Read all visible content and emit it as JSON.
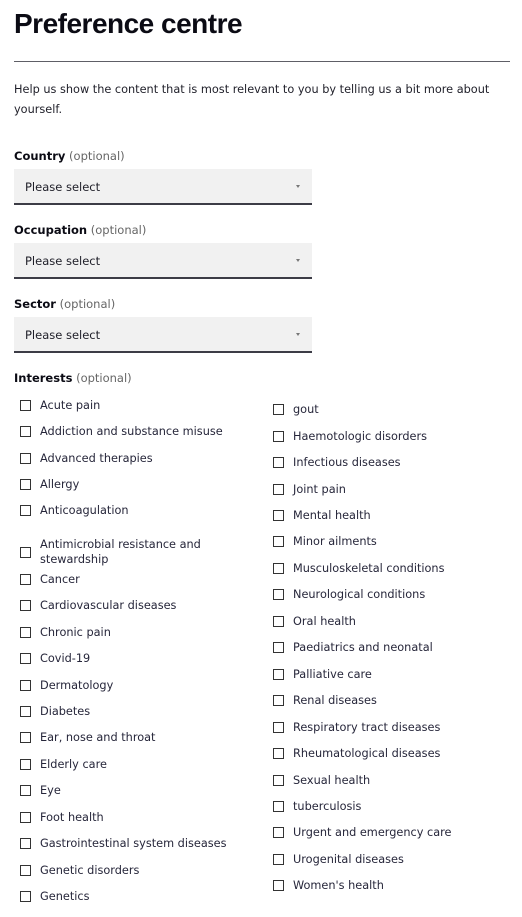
{
  "page": {
    "title": "Preference centre",
    "intro": "Help us show the content that is most relevant to you by telling us a bit more about yourself."
  },
  "fields": {
    "country": {
      "label": "Country",
      "optional": "(optional)",
      "value": "Please select"
    },
    "occupation": {
      "label": "Occupation",
      "optional": "(optional)",
      "value": "Please select"
    },
    "sector": {
      "label": "Sector",
      "optional": "(optional)",
      "value": "Please select"
    }
  },
  "interests": {
    "label": "Interests",
    "optional": "(optional)",
    "left_column": [
      {
        "label": "Acute pain",
        "checked": false
      },
      {
        "label": "Addiction and substance misuse",
        "checked": false
      },
      {
        "label": "Advanced therapies",
        "checked": false
      },
      {
        "label": "Allergy",
        "checked": false
      },
      {
        "label": "Anticoagulation",
        "checked": false
      },
      {
        "label": "Antimicrobial resistance and stewardship",
        "checked": false
      },
      {
        "label": "Cancer",
        "checked": false
      },
      {
        "label": "Cardiovascular diseases",
        "checked": false
      },
      {
        "label": "Chronic pain",
        "checked": false
      },
      {
        "label": "Covid-19",
        "checked": false
      },
      {
        "label": "Dermatology",
        "checked": false
      },
      {
        "label": "Diabetes",
        "checked": false
      },
      {
        "label": "Ear, nose and throat",
        "checked": false
      },
      {
        "label": "Elderly care",
        "checked": false
      },
      {
        "label": "Eye",
        "checked": false
      },
      {
        "label": "Foot health",
        "checked": false
      },
      {
        "label": "Gastrointestinal system diseases",
        "checked": false
      },
      {
        "label": "Genetic disorders",
        "checked": false
      },
      {
        "label": "Genetics",
        "checked": false
      }
    ],
    "right_column": [
      {
        "label": "gout",
        "checked": false
      },
      {
        "label": "Haemotologic disorders",
        "checked": false
      },
      {
        "label": "Infectious diseases",
        "checked": false
      },
      {
        "label": "Joint pain",
        "checked": false
      },
      {
        "label": "Mental health",
        "checked": false
      },
      {
        "label": "Minor ailments",
        "checked": false
      },
      {
        "label": "Musculoskeletal conditions",
        "checked": false
      },
      {
        "label": "Neurological conditions",
        "checked": false
      },
      {
        "label": "Oral health",
        "checked": false
      },
      {
        "label": "Paediatrics and neonatal",
        "checked": false
      },
      {
        "label": "Palliative care",
        "checked": false
      },
      {
        "label": "Renal diseases",
        "checked": false
      },
      {
        "label": "Respiratory tract diseases",
        "checked": false
      },
      {
        "label": "Rheumatological diseases",
        "checked": false
      },
      {
        "label": "Sexual health",
        "checked": false
      },
      {
        "label": "tuberculosis",
        "checked": false
      },
      {
        "label": "Urgent and emergency care",
        "checked": false
      },
      {
        "label": "Urogenital diseases",
        "checked": false
      },
      {
        "label": "Women's health",
        "checked": false
      }
    ]
  }
}
